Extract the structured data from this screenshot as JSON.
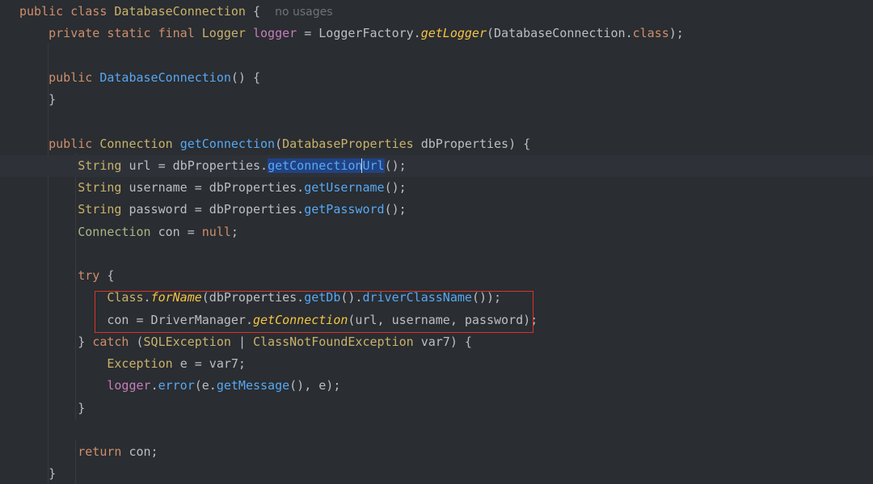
{
  "editor": {
    "lines": [
      [
        {
          "t": "kw",
          "v": "public class "
        },
        {
          "t": "cls",
          "v": "DatabaseConnection"
        },
        {
          "t": "pl",
          "v": " {  "
        },
        {
          "t": "hint",
          "v": "no usages"
        }
      ],
      [
        {
          "t": "kw",
          "v": "    private static final "
        },
        {
          "t": "cls",
          "v": "Logger "
        },
        {
          "t": "var",
          "v": "logger"
        },
        {
          "t": "pl",
          "v": " = LoggerFactory."
        },
        {
          "t": "fi",
          "v": "getLogger"
        },
        {
          "t": "pl",
          "v": "(DatabaseConnection."
        },
        {
          "t": "kw",
          "v": "class"
        },
        {
          "t": "pl",
          "v": ");"
        }
      ],
      [],
      [
        {
          "t": "kw",
          "v": "    public "
        },
        {
          "t": "fn",
          "v": "DatabaseConnection"
        },
        {
          "t": "pl",
          "v": "() {"
        }
      ],
      [
        {
          "t": "pl",
          "v": "    }"
        }
      ],
      [],
      [
        {
          "t": "kw",
          "v": "    public "
        },
        {
          "t": "cls",
          "v": "Connection "
        },
        {
          "t": "fn",
          "v": "getConnection"
        },
        {
          "t": "pl",
          "v": "("
        },
        {
          "t": "cls",
          "v": "DatabaseProperties "
        },
        {
          "t": "pl",
          "v": "dbProperties) {"
        }
      ],
      [
        {
          "t": "pl",
          "v": "        "
        },
        {
          "t": "cls",
          "v": "String "
        },
        {
          "t": "pl",
          "v": "url = dbProperties."
        },
        {
          "t": "fn",
          "sel": true,
          "v": "getConnection"
        },
        {
          "t": "caret",
          "v": ""
        },
        {
          "t": "fn",
          "sel": true,
          "v": "Url"
        },
        {
          "t": "pl",
          "v": "();"
        }
      ],
      [
        {
          "t": "pl",
          "v": "        "
        },
        {
          "t": "cls",
          "v": "String "
        },
        {
          "t": "pl",
          "v": "username = dbProperties."
        },
        {
          "t": "fn",
          "v": "getUsername"
        },
        {
          "t": "pl",
          "v": "();"
        }
      ],
      [
        {
          "t": "pl",
          "v": "        "
        },
        {
          "t": "cls",
          "v": "String "
        },
        {
          "t": "pl",
          "v": "password = dbProperties."
        },
        {
          "t": "fn",
          "v": "getPassword"
        },
        {
          "t": "pl",
          "v": "();"
        }
      ],
      [
        {
          "t": "pl",
          "v": "        "
        },
        {
          "t": "lcl",
          "v": "Connection "
        },
        {
          "t": "pl",
          "v": "con = "
        },
        {
          "t": "kw",
          "v": "null"
        },
        {
          "t": "pl",
          "v": ";"
        }
      ],
      [],
      [
        {
          "t": "kw",
          "v": "        try "
        },
        {
          "t": "pl",
          "v": "{"
        }
      ],
      [
        {
          "t": "pl",
          "v": "            "
        },
        {
          "t": "cls",
          "v": "Class"
        },
        {
          "t": "pl",
          "v": "."
        },
        {
          "t": "fi",
          "v": "forName"
        },
        {
          "t": "pl",
          "v": "(dbProperties."
        },
        {
          "t": "fn",
          "v": "getDb"
        },
        {
          "t": "pl",
          "v": "()."
        },
        {
          "t": "fn",
          "v": "driverClassName"
        },
        {
          "t": "pl",
          "v": "());"
        }
      ],
      [
        {
          "t": "pl",
          "v": "            con = DriverManager."
        },
        {
          "t": "fi",
          "v": "getConnection"
        },
        {
          "t": "pl",
          "v": "(url, username, password);"
        }
      ],
      [
        {
          "t": "pl",
          "v": "        } "
        },
        {
          "t": "kw",
          "v": "catch "
        },
        {
          "t": "pl",
          "v": "("
        },
        {
          "t": "cls",
          "v": "SQLException "
        },
        {
          "t": "pl",
          "v": "| "
        },
        {
          "t": "cls",
          "v": "ClassNotFoundException "
        },
        {
          "t": "pl",
          "v": "var7) {"
        }
      ],
      [
        {
          "t": "pl",
          "v": "            "
        },
        {
          "t": "cls",
          "v": "Exception "
        },
        {
          "t": "pl",
          "v": "e = var7;"
        }
      ],
      [
        {
          "t": "pl",
          "v": "            "
        },
        {
          "t": "var",
          "v": "logger"
        },
        {
          "t": "pl",
          "v": "."
        },
        {
          "t": "fn",
          "v": "error"
        },
        {
          "t": "pl",
          "v": "(e."
        },
        {
          "t": "fn",
          "v": "getMessage"
        },
        {
          "t": "pl",
          "v": "(), e);"
        }
      ],
      [
        {
          "t": "pl",
          "v": "        }"
        }
      ],
      [],
      [
        {
          "t": "kw",
          "v": "        return "
        },
        {
          "t": "pl",
          "v": "con;"
        }
      ],
      [
        {
          "t": "pl",
          "v": "    }"
        }
      ]
    ],
    "caret_line": 7,
    "highlight_annotation_color": "#d9322c"
  }
}
